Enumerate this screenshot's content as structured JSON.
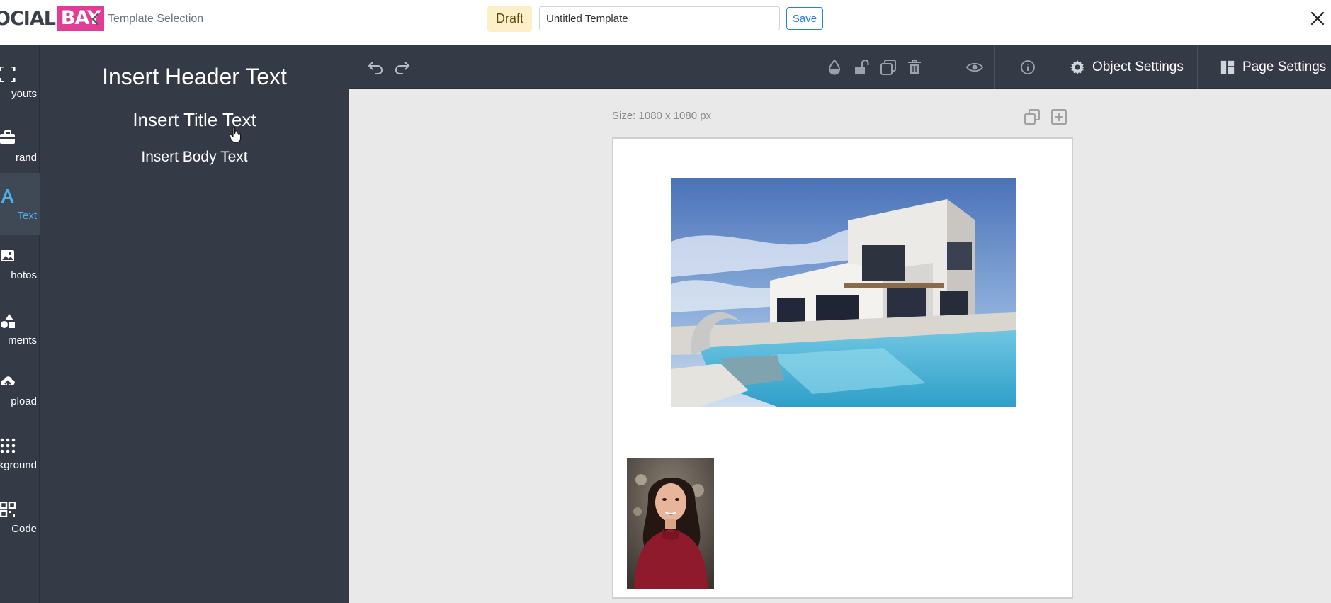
{
  "header": {
    "logo_left": "OCIAL",
    "logo_right": "BAY",
    "back_label": "Template Selection",
    "status_badge": "Draft",
    "template_name": "Untitled Template",
    "save_label": "Save"
  },
  "rail": {
    "items": [
      {
        "label": "youts",
        "icon": "layouts-icon"
      },
      {
        "label": "rand",
        "icon": "briefcase-icon"
      },
      {
        "label": "Text",
        "icon": "text-icon",
        "active": true
      },
      {
        "label": "hotos",
        "icon": "photos-icon"
      },
      {
        "label": "ments",
        "icon": "shapes-icon"
      },
      {
        "label": "pload",
        "icon": "upload-icon"
      },
      {
        "label": "kground",
        "icon": "dots-grid-icon"
      },
      {
        "label": "Code",
        "icon": "qr-code-icon"
      }
    ]
  },
  "text_panel": {
    "header_text": "Insert Header Text",
    "title_text": "Insert Title Text",
    "body_text": "Insert Body Text"
  },
  "toolbar": {
    "object_settings": "Object Settings",
    "page_settings": "Page Settings"
  },
  "canvas": {
    "size_label": "Size: 1080 x 1080 px"
  },
  "colors": {
    "panel_bg": "#353b46",
    "accent_blue": "#2a7de1",
    "brand_pink": "#e23d96",
    "active_text": "#4fb0e8",
    "draft_bg": "#fdefc8"
  }
}
